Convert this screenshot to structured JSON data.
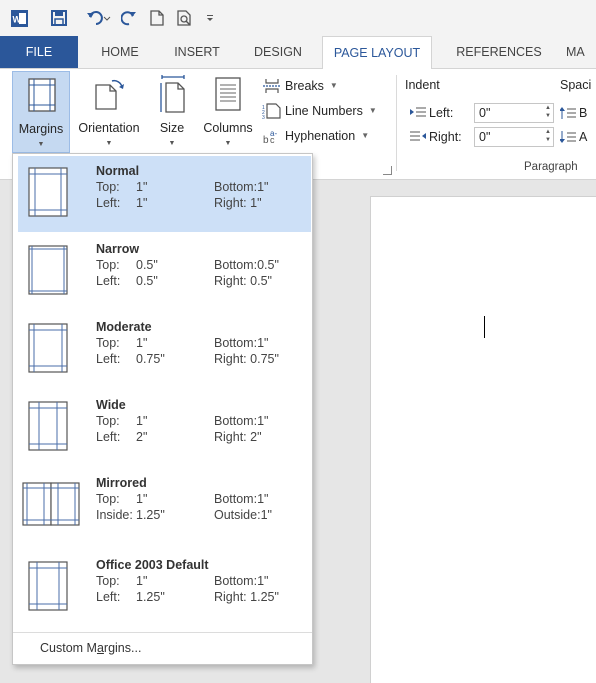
{
  "qat": {
    "icons": [
      "word-logo-icon",
      "save-icon",
      "undo-icon",
      "redo-icon",
      "new-document-icon",
      "print-preview-icon",
      "customize-qat-icon"
    ]
  },
  "tabs": {
    "file": "FILE",
    "home": "HOME",
    "insert": "INSERT",
    "design": "DESIGN",
    "page_layout": "PAGE LAYOUT",
    "references": "REFERENCES",
    "mailings_partial": "MA"
  },
  "ribbon": {
    "margins": "Margins",
    "orientation": "Orientation",
    "size": "Size",
    "columns": "Columns",
    "breaks": "Breaks",
    "line_numbers": "Line Numbers",
    "hyphenation": "Hyphenation",
    "indent_title": "Indent",
    "spacing_title_partial": "Spaci",
    "left_label": "Left:",
    "left_value": "0\"",
    "right_label": "Right:",
    "right_value": "0\"",
    "spacing_before_partial": "B",
    "spacing_after_partial": "A",
    "paragraph_group": "Paragraph"
  },
  "margins_menu": {
    "items": [
      {
        "name": "Normal",
        "top_label": "Top:",
        "top": "1\"",
        "bottom_label": "Bottom:",
        "bottom": "1\"",
        "left_label": "Left:",
        "left": "1\"",
        "right_label": "Right:",
        "right": "1\"",
        "selected": true
      },
      {
        "name": "Narrow",
        "top_label": "Top:",
        "top": "0.5\"",
        "bottom_label": "Bottom:",
        "bottom": "0.5\"",
        "left_label": "Left:",
        "left": "0.5\"",
        "right_label": "Right:",
        "right": "0.5\""
      },
      {
        "name": "Moderate",
        "top_label": "Top:",
        "top": "1\"",
        "bottom_label": "Bottom:",
        "bottom": "1\"",
        "left_label": "Left:",
        "left": "0.75\"",
        "right_label": "Right:",
        "right": "0.75\""
      },
      {
        "name": "Wide",
        "top_label": "Top:",
        "top": "1\"",
        "bottom_label": "Bottom:",
        "bottom": "1\"",
        "left_label": "Left:",
        "left": "2\"",
        "right_label": "Right:",
        "right": "2\""
      },
      {
        "name": "Mirrored",
        "top_label": "Top:",
        "top": "1\"",
        "bottom_label": "Bottom:",
        "bottom": "1\"",
        "left_label": "Inside:",
        "left": "1.25\"",
        "right_label": "Outside:",
        "right": "1\""
      },
      {
        "name": "Office 2003 Default",
        "top_label": "Top:",
        "top": "1\"",
        "bottom_label": "Bottom:",
        "bottom": "1\"",
        "left_label": "Left:",
        "left": "1.25\"",
        "right_label": "Right:",
        "right": "1.25\""
      }
    ],
    "custom_prefix": "Custom M",
    "custom_accel": "a",
    "custom_suffix": "rgins..."
  },
  "colors": {
    "accent": "#2b579a",
    "selected_bg": "#cde0f7"
  }
}
